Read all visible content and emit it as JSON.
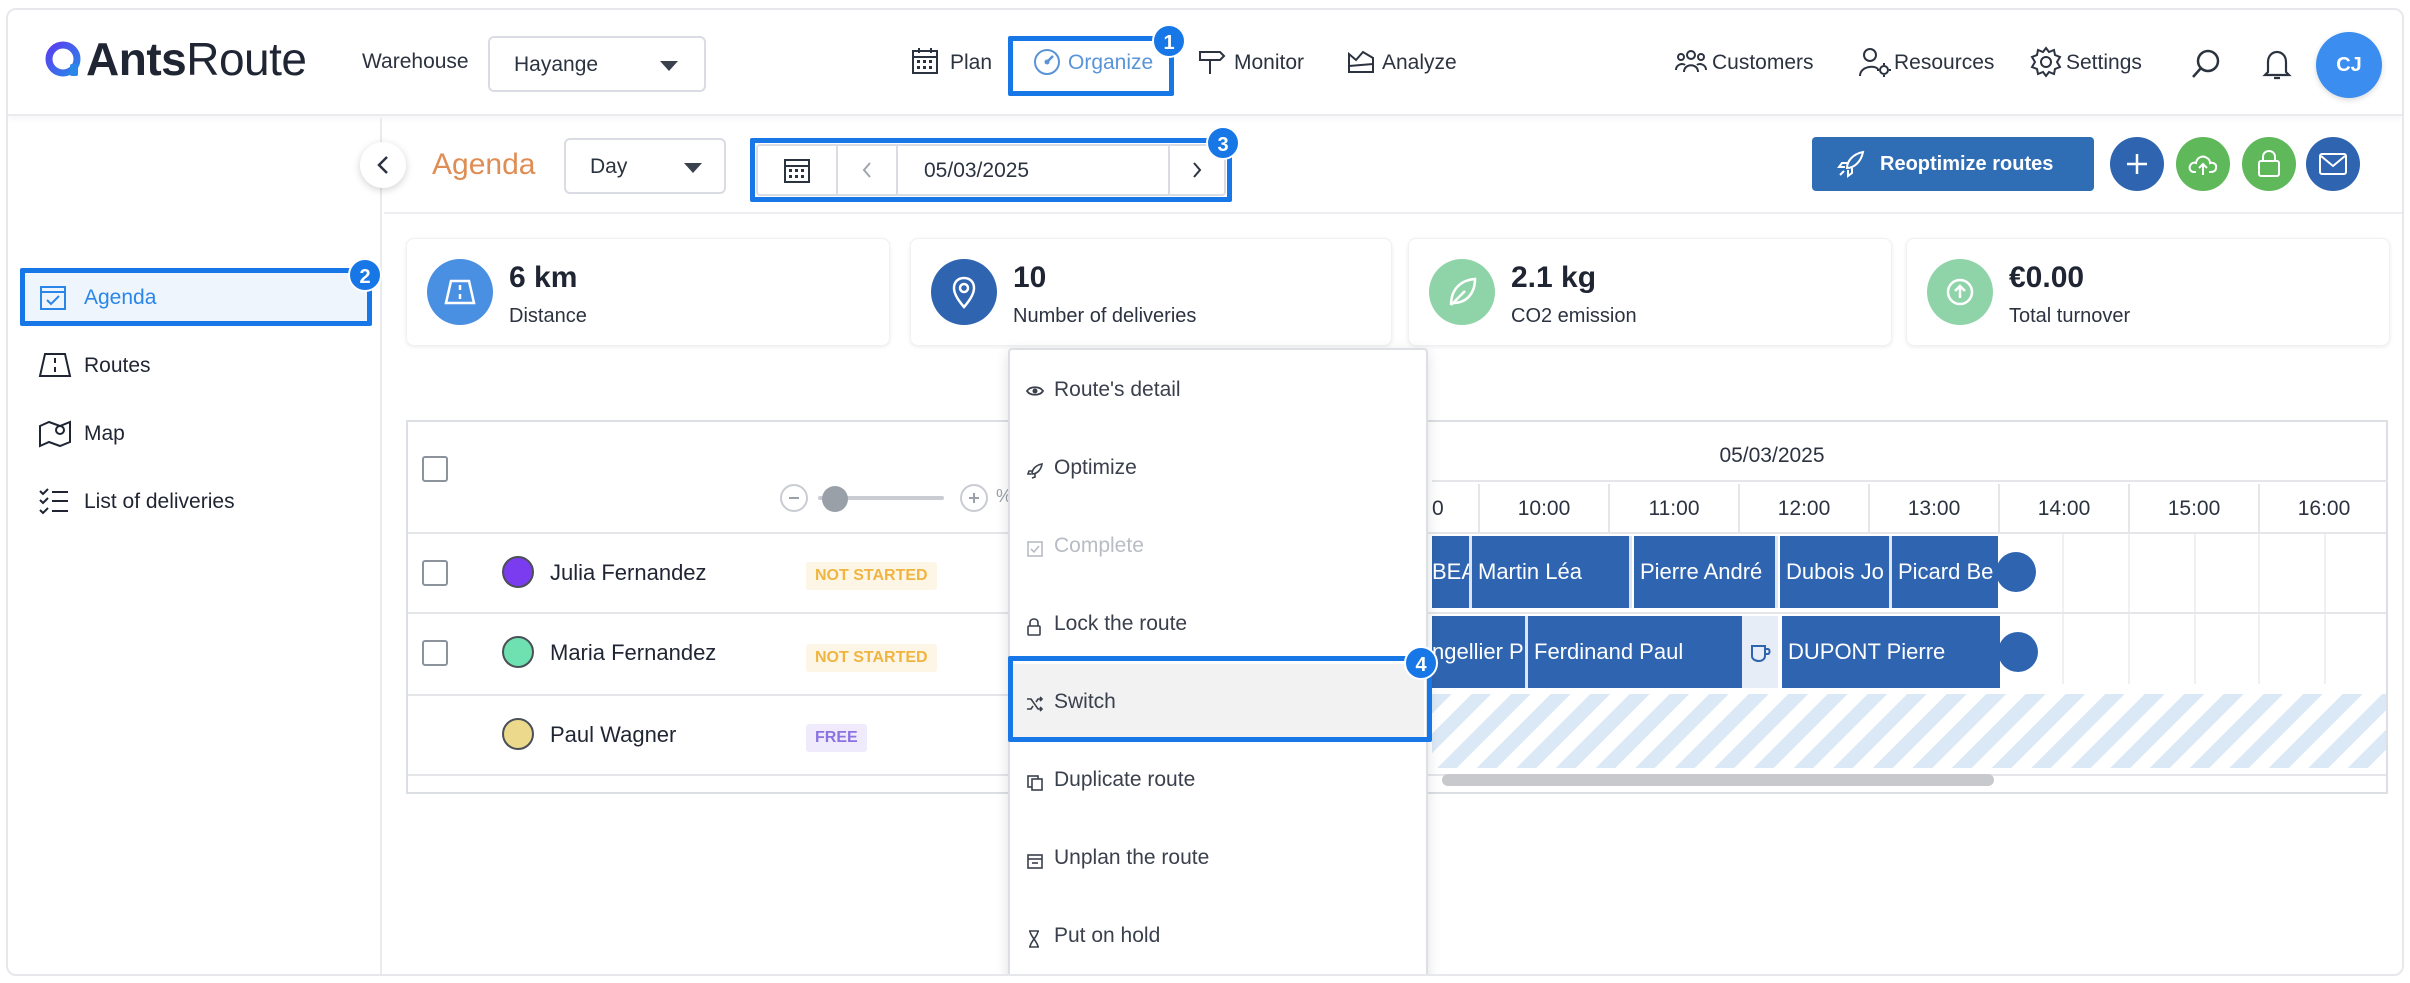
{
  "nav": {
    "logo_bold": "Ants",
    "logo_light": "Route",
    "warehouse_label": "Warehouse",
    "warehouse_value": "Hayange",
    "items": [
      {
        "label": "Plan",
        "icon": "calendar-grid-icon"
      },
      {
        "label": "Organize",
        "icon": "speedometer-icon"
      },
      {
        "label": "Monitor",
        "icon": "signpost-icon"
      },
      {
        "label": "Analyze",
        "icon": "chart-area-icon"
      }
    ],
    "right_items": [
      {
        "label": "Customers",
        "icon": "group-icon"
      },
      {
        "label": "Resources",
        "icon": "user-gear-icon"
      },
      {
        "label": "Settings",
        "icon": "gear-icon"
      }
    ],
    "avatar_initials": "CJ"
  },
  "annotations": [
    "1",
    "2",
    "3",
    "4"
  ],
  "sidebar": {
    "items": [
      {
        "label": "Agenda",
        "icon": "calendar-check-icon"
      },
      {
        "label": "Routes",
        "icon": "road-icon"
      },
      {
        "label": "Map",
        "icon": "map-pin-icon"
      },
      {
        "label": "List of deliveries",
        "icon": "checklist-icon"
      }
    ]
  },
  "header": {
    "title": "Agenda",
    "view_select": "Day",
    "date": "05/03/2025",
    "reoptimize_label": "Reoptimize routes"
  },
  "colors": {
    "accent_blue": "#1877e6",
    "primary_dark": "#2f65b0",
    "agenda_orange": "#e08d55",
    "green": "#5fb85a"
  },
  "stats": [
    {
      "value": "6 km",
      "label": "Distance",
      "icon_color": "#4a90e2"
    },
    {
      "value": "10",
      "label": "Number of deliveries",
      "icon_color": "#2f65b0"
    },
    {
      "value": "2.1 kg",
      "label": "CO2 emission",
      "icon_color": "#8fd4a8"
    },
    {
      "value": "€0.00",
      "label": "Total turnover",
      "icon_color": "#8fd4a8"
    }
  ],
  "agenda": {
    "timeline_date": "05/03/2025",
    "zoom_percent_glyph": "%",
    "hours": [
      "0",
      "10:00",
      "11:00",
      "12:00",
      "13:00",
      "14:00",
      "15:00",
      "16:00"
    ],
    "rows": [
      {
        "name": "Julia Fernandez",
        "status": "NOT STARTED",
        "dot_color": "#7b3cf0",
        "blocks": [
          "BEAU",
          "Martin Léa",
          "Pierre André",
          "Dubois Jo",
          "Picard Be"
        ]
      },
      {
        "name": "Maria Fernandez",
        "status": "NOT STARTED",
        "dot_color": "#6fe0b0",
        "blocks": [
          "ngellier P",
          "Ferdinand Paul",
          "DUPONT Pierre"
        ]
      },
      {
        "name": "Paul Wagner",
        "status": "FREE",
        "dot_color": "#ecd98c",
        "blocks": []
      }
    ]
  },
  "context_menu": {
    "items": [
      {
        "label": "Route's detail",
        "icon": "eye-icon",
        "disabled": false
      },
      {
        "label": "Optimize",
        "icon": "rocket-icon",
        "disabled": false
      },
      {
        "label": "Complete",
        "icon": "check-square-icon",
        "disabled": true
      },
      {
        "label": "Lock the route",
        "icon": "lock-icon",
        "disabled": false
      },
      {
        "label": "Switch",
        "icon": "shuffle-icon",
        "disabled": false
      },
      {
        "label": "Duplicate route",
        "icon": "copy-icon",
        "disabled": false
      },
      {
        "label": "Unplan the route",
        "icon": "calendar-remove-icon",
        "disabled": false
      },
      {
        "label": "Put on hold",
        "icon": "hourglass-icon",
        "disabled": false
      }
    ]
  }
}
